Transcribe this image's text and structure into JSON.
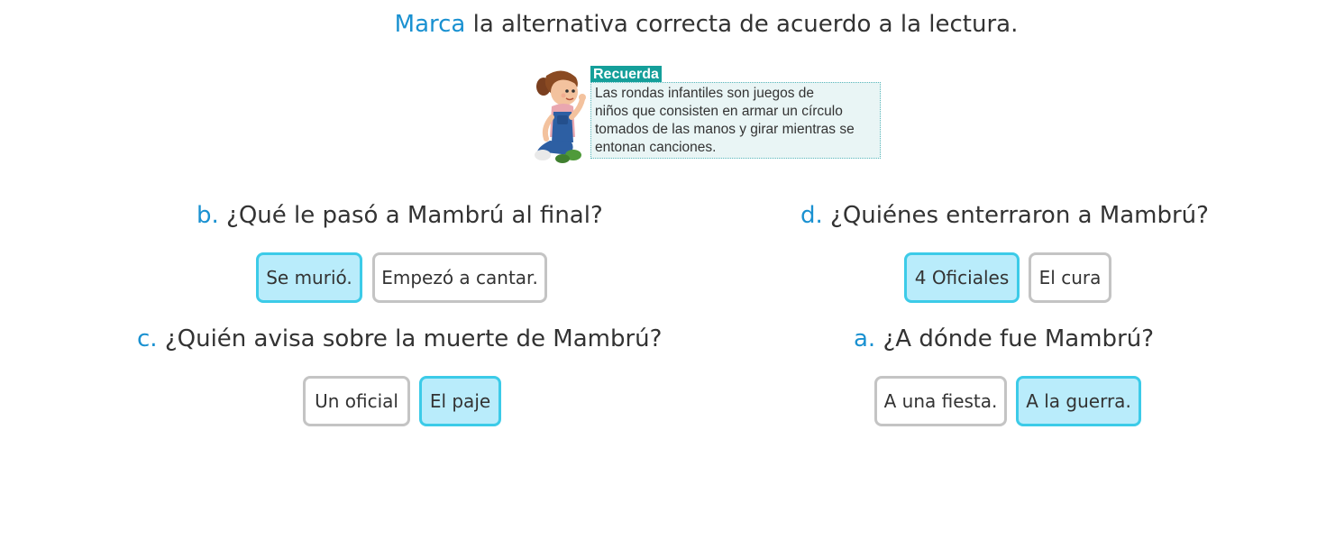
{
  "instruction": {
    "highlight": "Marca",
    "rest": " la alternativa correcta de acuerdo a la lectura."
  },
  "recuerda": {
    "title": "Recuerda",
    "lines": [
      "Las rondas infantiles son juegos de",
      "niños que consisten en armar un círculo",
      "tomados de las manos y girar mientras se",
      "entonan canciones."
    ]
  },
  "questions": {
    "b": {
      "letter": "b.",
      "text": "¿Qué le pasó a Mambrú al final?",
      "options": [
        {
          "label": "Se murió.",
          "selected": true
        },
        {
          "label": "Empezó a cantar.",
          "selected": false
        }
      ]
    },
    "d": {
      "letter": "d.",
      "text": "¿Quiénes enterraron a Mambrú?",
      "options": [
        {
          "label": "4 Oficiales",
          "selected": true
        },
        {
          "label": "El cura",
          "selected": false
        }
      ]
    },
    "c": {
      "letter": "c.",
      "text": "¿Quién avisa sobre la muerte de Mambrú?",
      "options": [
        {
          "label": "Un oficial",
          "selected": false
        },
        {
          "label": "El paje",
          "selected": true
        }
      ]
    },
    "a": {
      "letter": "a.",
      "text": "¿A dónde fue Mambrú?",
      "options": [
        {
          "label": "A una fiesta.",
          "selected": false
        },
        {
          "label": "A la guerra.",
          "selected": true
        }
      ]
    }
  },
  "colors": {
    "accent": "#1a91d1",
    "selected_border": "#3ccbe8",
    "selected_fill": "#b9ecfb",
    "unselected_border": "#c4c4c4",
    "recuerda_header": "#149f9a"
  }
}
